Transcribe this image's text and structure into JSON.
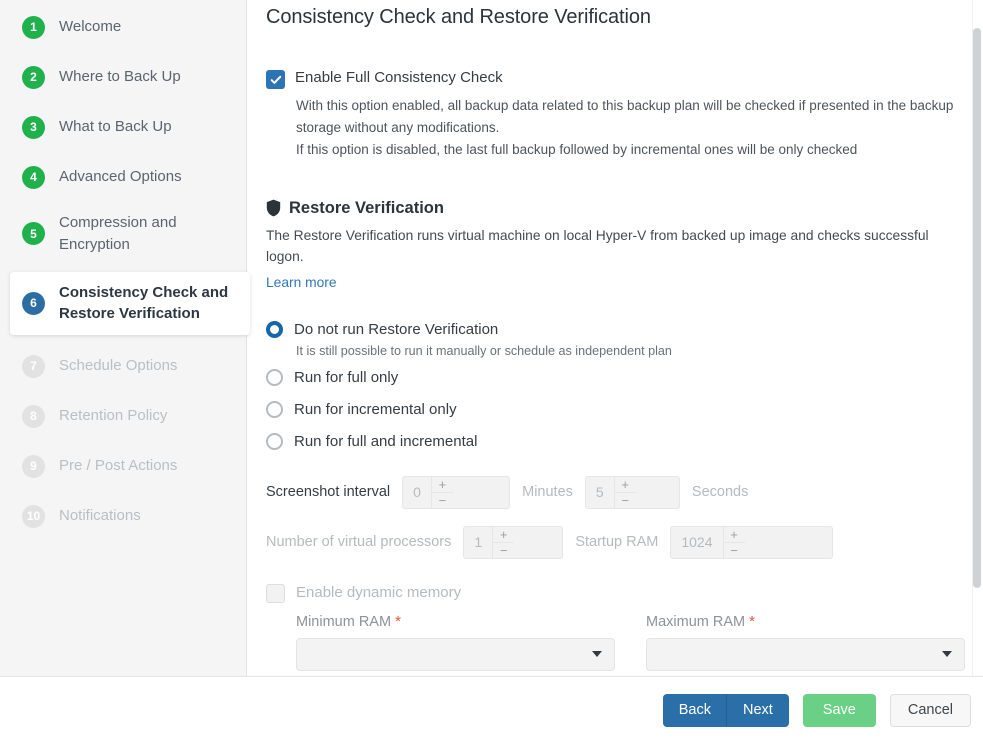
{
  "sidebar": {
    "steps": [
      {
        "num": "1",
        "label": "Welcome",
        "state": "done"
      },
      {
        "num": "2",
        "label": "Where to Back Up",
        "state": "done"
      },
      {
        "num": "3",
        "label": "What to Back Up",
        "state": "done"
      },
      {
        "num": "4",
        "label": "Advanced Options",
        "state": "done"
      },
      {
        "num": "5",
        "label": "Compression and Encryption",
        "state": "done"
      },
      {
        "num": "6",
        "label": "Consistency Check and Restore Verification",
        "state": "active"
      },
      {
        "num": "7",
        "label": "Schedule Options",
        "state": "disabled"
      },
      {
        "num": "8",
        "label": "Retention Policy",
        "state": "disabled"
      },
      {
        "num": "9",
        "label": "Pre / Post Actions",
        "state": "disabled"
      },
      {
        "num": "10",
        "label": "Notifications",
        "state": "disabled"
      }
    ]
  },
  "main": {
    "title": "Consistency Check and Restore Verification",
    "consistency": {
      "checkbox_label": "Enable Full Consistency Check",
      "checked": true,
      "desc_line1": "With this option enabled, all backup data related to this backup plan will be checked if presented in the backup storage without any modifications.",
      "desc_line2": "If this option is disabled, the last full backup followed by incremental ones will be only checked"
    },
    "restore_verification": {
      "icon": "shield-icon",
      "title": "Restore Verification",
      "description": "The Restore Verification runs virtual machine on local Hyper-V from backed up image and checks successful logon.",
      "learn_more": "Learn more",
      "options": [
        {
          "label": "Do not run Restore Verification",
          "selected": true,
          "sub": "It is still possible to run it manually or schedule as independent plan"
        },
        {
          "label": "Run for full only",
          "selected": false,
          "sub": ""
        },
        {
          "label": "Run for incremental only",
          "selected": false,
          "sub": ""
        },
        {
          "label": "Run for full and incremental",
          "selected": false,
          "sub": ""
        }
      ]
    },
    "screenshot_interval": {
      "label": "Screenshot interval",
      "minutes_value": "0",
      "minutes_unit": "Minutes",
      "seconds_value": "5",
      "seconds_unit": "Seconds",
      "plus": "+",
      "minus": "−"
    },
    "vm_resources": {
      "processors_label": "Number of virtual processors",
      "processors_value": "1",
      "startup_ram_label": "Startup RAM",
      "startup_ram_value": "1024"
    },
    "dynamic_memory": {
      "checkbox_label": "Enable dynamic memory",
      "checked": false,
      "min_ram_label": "Minimum RAM",
      "min_ram_value": "",
      "max_ram_label": "Maximum RAM",
      "max_ram_value": "",
      "required_marker": "*"
    }
  },
  "footer": {
    "back": "Back",
    "next": "Next",
    "save": "Save",
    "cancel": "Cancel"
  },
  "colors": {
    "step_done": "#21b14c",
    "step_active": "#2c6ea4",
    "step_disabled": "#e2e2e2",
    "accent_blue": "#2b6fa8",
    "checkbox_blue": "#2c74b3",
    "radio_blue": "#1667a8",
    "link_blue": "#3277b5",
    "save_green": "#6ad086",
    "required_red": "#e8503a"
  }
}
